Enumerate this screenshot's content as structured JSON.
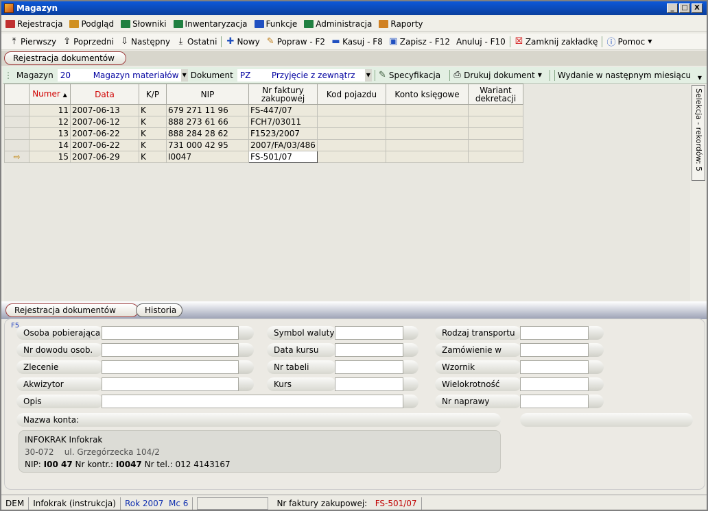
{
  "window": {
    "title": "Magazyn",
    "min": "_",
    "max": "□",
    "close": "X"
  },
  "menu": [
    {
      "label": "Rejestracja",
      "color": "#c03030"
    },
    {
      "label": "Podgląd",
      "color": "#d09020"
    },
    {
      "label": "Słowniki",
      "color": "#208040"
    },
    {
      "label": "Inwentaryzacja",
      "color": "#208040"
    },
    {
      "label": "Funkcje",
      "color": "#2050c0"
    },
    {
      "label": "Administracja",
      "color": "#208040"
    },
    {
      "label": "Raporty",
      "color": "#d08020"
    }
  ],
  "toolbar": {
    "first": "Pierwszy",
    "prev": "Poprzedni",
    "next": "Następny",
    "last": "Ostatni",
    "new": "Nowy",
    "edit": "Popraw - F2",
    "delete": "Kasuj - F8",
    "save": "Zapisz - F12",
    "cancel": "Anuluj - F10",
    "close_tab": "Zamknij zakładkę",
    "help": "Pomoc"
  },
  "top_tab": "Rejestracja dokumentów",
  "filter": {
    "magazyn_label": "Magazyn",
    "magazyn_code": "20",
    "magazyn_name": "Magazyn materiałów",
    "dokument_label": "Dokument",
    "dokument_code": "PZ",
    "dokument_name": "Przyjęcie z zewnątrz",
    "spec": "Specyfikacja",
    "print": "Drukuj dokument",
    "next_month": "Wydanie w następnym miesiącu"
  },
  "grid": {
    "headers": {
      "numer": "Numer",
      "data": "Data",
      "kp": "K/P",
      "nip": "NIP",
      "nr_faktury": "Nr faktury zakupowej",
      "kod_pojazdu": "Kod pojazdu",
      "konto": "Konto księgowe",
      "wariant": "Wariant dekretacji"
    },
    "rows": [
      {
        "numer": "11",
        "data": "2007-06-13",
        "kp": "K",
        "nip": "679 271 11 96",
        "faktura": "FS-447/07"
      },
      {
        "numer": "12",
        "data": "2007-06-12",
        "kp": "K",
        "nip": "888 273 61 66",
        "faktura": "FCH7/03011"
      },
      {
        "numer": "13",
        "data": "2007-06-22",
        "kp": "K",
        "nip": "888 284 28 62",
        "faktura": "F1523/2007"
      },
      {
        "numer": "14",
        "data": "2007-06-22",
        "kp": "K",
        "nip": "731 000 42 95",
        "faktura": "2007/FA/03/486"
      },
      {
        "numer": "15",
        "data": "2007-06-29",
        "kp": "K",
        "nip": "I0047",
        "faktura": "FS-501/07"
      }
    ]
  },
  "side_tab": "Selekcja - rekordów: 5",
  "bottom_tabs": {
    "reg": "Rejestracja dokumentów",
    "hist": "Historia"
  },
  "form": {
    "f5": "F5",
    "osoba": "Osoba pobierająca",
    "dowod": "Nr dowodu osob.",
    "zlecenie": "Zlecenie",
    "akwizytor": "Akwizytor",
    "opis": "Opis",
    "waluta": "Symbol waluty",
    "data_kursu": "Data kursu",
    "nr_tabeli": "Nr tabeli",
    "kurs": "Kurs",
    "transport": "Rodzaj transportu",
    "zamowienie": "Zamówienie w",
    "wzornik": "Wzornik",
    "wielokrotnosc": "Wielokrotność",
    "nr_naprawy": "Nr naprawy",
    "nazwa_konta": "Nazwa konta:"
  },
  "info": {
    "name": "INFOKRAK Infokrak",
    "postcode": "30-072",
    "street": "ul. Grzegórzecka 104/2",
    "nip_label": "NIP:",
    "nip": "I00 47",
    "kontr_label": "Nr kontr.:",
    "kontr": "I0047",
    "tel_label": "Nr tel.:",
    "tel": "012 4143167"
  },
  "status": {
    "dem": "DEM",
    "company": "Infokrak (instrukcja)",
    "year": "Rok 2007",
    "month": "Mc 6",
    "invoice_label": "Nr faktury zakupowej:",
    "invoice": "FS-501/07"
  }
}
